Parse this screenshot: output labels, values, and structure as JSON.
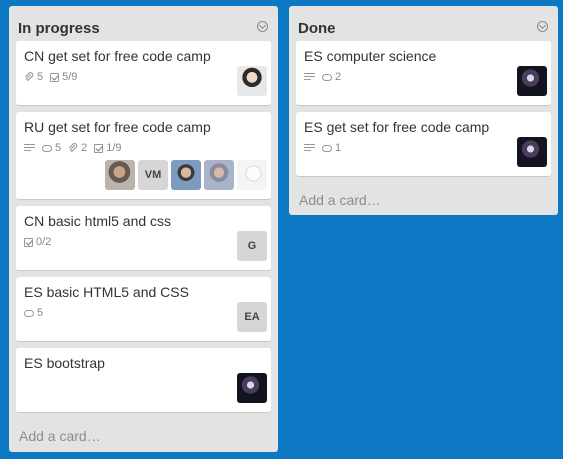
{
  "lists": [
    {
      "title": "In progress",
      "add_card_label": "Add a card…",
      "cards": [
        {
          "title": "CN get set for free code camp",
          "badges": [
            {
              "icon": "attachment-icon",
              "value": "5"
            },
            {
              "icon": "checklist-icon",
              "value": "5/9"
            }
          ],
          "members": [
            {
              "type": "photo",
              "style": "portrait-light"
            }
          ]
        },
        {
          "title": "RU get set for free code camp",
          "badges": [
            {
              "icon": "description-icon",
              "value": ""
            },
            {
              "icon": "comment-icon",
              "value": "5"
            },
            {
              "icon": "attachment-icon",
              "value": "2"
            },
            {
              "icon": "checklist-icon",
              "value": "1/9"
            }
          ],
          "members": [
            {
              "type": "photo",
              "style": "portrait-warm"
            },
            {
              "type": "initials",
              "initials": "VM"
            },
            {
              "type": "photo",
              "style": "portrait-blue"
            },
            {
              "type": "photo",
              "style": "portrait-grey"
            },
            {
              "type": "photo",
              "style": "sketch"
            }
          ]
        },
        {
          "title": "CN basic html5 and css",
          "badges": [
            {
              "icon": "checklist-icon",
              "value": "0/2"
            }
          ],
          "members": [
            {
              "type": "initials",
              "initials": "G"
            }
          ]
        },
        {
          "title": "ES basic HTML5 and CSS",
          "badges": [
            {
              "icon": "comment-icon",
              "value": "5"
            }
          ],
          "members": [
            {
              "type": "initials",
              "initials": "EA"
            }
          ]
        },
        {
          "title": "ES bootstrap",
          "badges": [],
          "members": [
            {
              "type": "photo",
              "style": "portrait-dark"
            }
          ]
        }
      ]
    },
    {
      "title": "Done",
      "add_card_label": "Add a card…",
      "cards": [
        {
          "title": "ES computer science",
          "badges": [
            {
              "icon": "description-icon",
              "value": ""
            },
            {
              "icon": "comment-icon",
              "value": "2"
            }
          ],
          "members": [
            {
              "type": "photo",
              "style": "portrait-dark"
            }
          ]
        },
        {
          "title": "ES get set for free code camp",
          "badges": [
            {
              "icon": "description-icon",
              "value": ""
            },
            {
              "icon": "comment-icon",
              "value": "1"
            }
          ],
          "members": [
            {
              "type": "photo",
              "style": "portrait-dark"
            }
          ]
        }
      ]
    }
  ],
  "colors": {
    "board_background": "#0c77c2",
    "list_background": "#e3e3e3",
    "card_background": "#ffffff"
  }
}
